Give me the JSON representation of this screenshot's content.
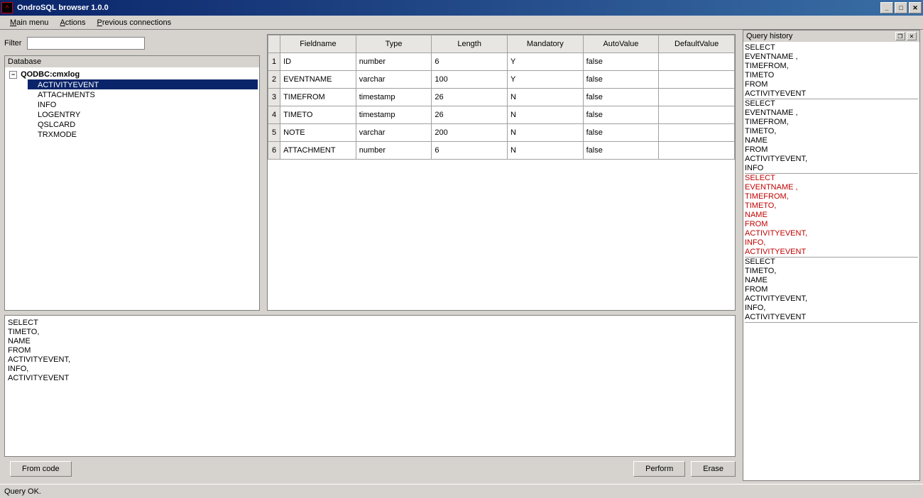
{
  "window": {
    "title": "OndroSQL browser 1.0.0"
  },
  "menu": {
    "main": "Main menu",
    "actions": "Actions",
    "prev": "Previous connections"
  },
  "filter": {
    "label": "Filter",
    "value": ""
  },
  "tree": {
    "title": "Database",
    "root": "QODBC:cmxlog",
    "children": [
      "ACTIVITYEVENT",
      "ATTACHMENTS",
      "INFO",
      "LOGENTRY",
      "QSLCARD",
      "TRXMODE"
    ],
    "selected": "ACTIVITYEVENT"
  },
  "grid": {
    "headers": [
      "Fieldname",
      "Type",
      "Length",
      "Mandatory",
      "AutoValue",
      "DefaultValue"
    ],
    "rows": [
      {
        "n": "1",
        "fieldname": "ID",
        "type": "number",
        "length": "6",
        "mandatory": "Y",
        "autovalue": "false",
        "defaultvalue": ""
      },
      {
        "n": "2",
        "fieldname": "EVENTNAME",
        "type": "varchar",
        "length": "100",
        "mandatory": "Y",
        "autovalue": "false",
        "defaultvalue": ""
      },
      {
        "n": "3",
        "fieldname": "TIMEFROM",
        "type": "timestamp",
        "length": "26",
        "mandatory": "N",
        "autovalue": "false",
        "defaultvalue": ""
      },
      {
        "n": "4",
        "fieldname": "TIMETO",
        "type": "timestamp",
        "length": "26",
        "mandatory": "N",
        "autovalue": "false",
        "defaultvalue": ""
      },
      {
        "n": "5",
        "fieldname": "NOTE",
        "type": "varchar",
        "length": "200",
        "mandatory": "N",
        "autovalue": "false",
        "defaultvalue": ""
      },
      {
        "n": "6",
        "fieldname": "ATTACHMENT",
        "type": "number",
        "length": "6",
        "mandatory": "N",
        "autovalue": "false",
        "defaultvalue": ""
      }
    ]
  },
  "sql": "SELECT\nTIMETO,\nNAME\n FROM\nACTIVITYEVENT,\nINFO,\nACTIVITYEVENT",
  "buttons": {
    "fromcode": "From code",
    "perform": "Perform",
    "erase": "Erase"
  },
  "status": "Query OK.",
  "history": {
    "title": "Query history",
    "entries": [
      {
        "text": "SELECT\nEVENTNAME ,\nTIMEFROM,\nTIMETO\n FROM\nACTIVITYEVENT",
        "error": false
      },
      {
        "text": "SELECT\nEVENTNAME ,\nTIMEFROM,\nTIMETO,\nNAME\n FROM\nACTIVITYEVENT,\nINFO",
        "error": false
      },
      {
        "text": "SELECT\nEVENTNAME ,\nTIMEFROM,\nTIMETO,\nNAME\n FROM\nACTIVITYEVENT,\nINFO,\nACTIVITYEVENT",
        "error": true
      },
      {
        "text": "SELECT\nTIMETO,\nNAME\n FROM\nACTIVITYEVENT,\nINFO,\nACTIVITYEVENT",
        "error": false
      }
    ]
  }
}
